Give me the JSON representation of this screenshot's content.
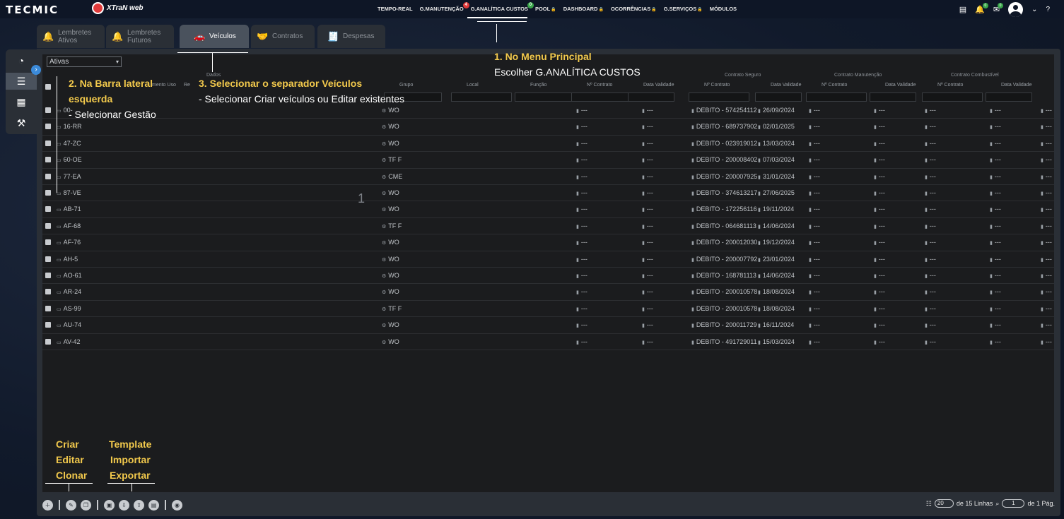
{
  "topbar": {
    "logo_tecmic": "TECMIC",
    "logo_xtran": "XTraN web",
    "menu": [
      {
        "label": "TEMPO-REAL",
        "badge": "",
        "lock": false
      },
      {
        "label": "G.MANUTENÇÃO",
        "badge": "4",
        "badge_color": "#e03a3a",
        "lock": false
      },
      {
        "label": "G.ANALÍTICA CUSTOS",
        "badge": "0",
        "badge_color": "#3aa64a",
        "lock": false
      },
      {
        "label": "POOL",
        "badge": "",
        "lock": true
      },
      {
        "label": "DASHBOARD",
        "badge": "",
        "lock": true
      },
      {
        "label": "OCORRÊNCIAS",
        "badge": "",
        "lock": true
      },
      {
        "label": "G.SERVIÇOS",
        "badge": "",
        "lock": true
      },
      {
        "label": "MÓDULOS",
        "badge": "",
        "lock": false
      }
    ],
    "notif_count": "0",
    "mail_count": "0"
  },
  "tabs": [
    {
      "label_1": "Lembretes",
      "label_2": "Ativos",
      "icon": "bell-icon",
      "glyph": "🔔"
    },
    {
      "label_1": "Lembretes",
      "label_2": "Futuros",
      "icon": "bell-clock-icon",
      "glyph": "🔔"
    },
    {
      "label_1": "Veículos",
      "label_2": "",
      "icon": "vehicle-icon",
      "glyph": "🚗"
    },
    {
      "label_1": "Contratos",
      "label_2": "",
      "icon": "handshake-icon",
      "glyph": "🤝"
    },
    {
      "label_1": "Despesas",
      "label_2": "",
      "icon": "expense-icon",
      "glyph": "🧾"
    }
  ],
  "filter": {
    "value": "Ativas"
  },
  "table": {
    "group_headers": [
      "Dados",
      "Contrato Seguro",
      "Contrato Manutenção",
      "Contrato Combustível"
    ],
    "col_headers": [
      "Grupo",
      "Local",
      "Função",
      "Nº Contrato",
      "Data Validade",
      "Nº Contrato",
      "Data Validade",
      "Nº Contrato",
      "Data Validade",
      "Nº Contrato",
      "Data Validade"
    ],
    "partial_headers": [
      "mento Uso",
      "Re"
    ],
    "rows": [
      {
        "plate": "00-",
        "group": "WO",
        "seg_contract": "DEBITO - 574254112",
        "seg_date": "26/09/2024"
      },
      {
        "plate": "16-RR",
        "group": "WO",
        "seg_contract": "DEBITO - 689737902",
        "seg_date": "02/01/2025"
      },
      {
        "plate": "47-ZC",
        "group": "WO",
        "seg_contract": "DEBITO - 023919012",
        "seg_date": "13/03/2024"
      },
      {
        "plate": "60-OE",
        "group": "TF F",
        "seg_contract": "DEBITO - 200008402",
        "seg_date": "07/03/2024"
      },
      {
        "plate": "77-EA",
        "group": "CME",
        "seg_contract": "DEBITO - 200007925",
        "seg_date": "31/01/2024"
      },
      {
        "plate": "87-VE",
        "group": "WO",
        "seg_contract": "DEBITO - 374613217",
        "seg_date": "27/06/2025"
      },
      {
        "plate": "AB-71",
        "group": "WO",
        "seg_contract": "DEBITO - 172256116",
        "seg_date": "19/11/2024"
      },
      {
        "plate": "AF-68",
        "group": "TF F",
        "seg_contract": "DEBITO - 064681113",
        "seg_date": "14/06/2024"
      },
      {
        "plate": "AF-76",
        "group": "WO",
        "seg_contract": "DEBITO - 200012030",
        "seg_date": "19/12/2024"
      },
      {
        "plate": "AH-5",
        "group": "WO",
        "seg_contract": "DEBITO - 200007792",
        "seg_date": "23/01/2024"
      },
      {
        "plate": "AO-61",
        "group": "WO",
        "seg_contract": "DEBITO - 168781113",
        "seg_date": "14/06/2024"
      },
      {
        "plate": "AR-24",
        "group": "WO",
        "seg_contract": "DEBITO - 200010578",
        "seg_date": "18/08/2024"
      },
      {
        "plate": "AS-99",
        "group": "TF F",
        "seg_contract": "DEBITO - 200010578",
        "seg_date": "18/08/2024"
      },
      {
        "plate": "AU-74",
        "group": "WO",
        "seg_contract": "DEBITO - 200011729",
        "seg_date": "16/11/2024"
      },
      {
        "plate": "AV-42",
        "group": "WO",
        "seg_contract": "DEBITO - 491729011",
        "seg_date": "15/03/2024"
      }
    ],
    "empty": "---"
  },
  "pager": {
    "rows_per_page": "20",
    "of_lines": "de 15 Linhas",
    "page": "1",
    "of_pages": "de 1 Pág."
  },
  "annotations": {
    "step1_title": "1. No Menu Principal",
    "step1_text": "Escolher  G.ANALÍTICA CUSTOS",
    "step2_title_1": "2. Na Barra lateral",
    "step2_title_2": "esquerda",
    "step2_text": "- Selecionar Gestão",
    "step3_title": "3. Selecionar o separador Veículos",
    "step3_text": "- Selecionar Criar veículos ou Editar existentes",
    "crud_1": "Criar",
    "crud_2": "Editar",
    "crud_3": "Clonar",
    "io_1": "Template",
    "io_2": "Importar",
    "io_3": "Exportar",
    "center_number": "1"
  }
}
